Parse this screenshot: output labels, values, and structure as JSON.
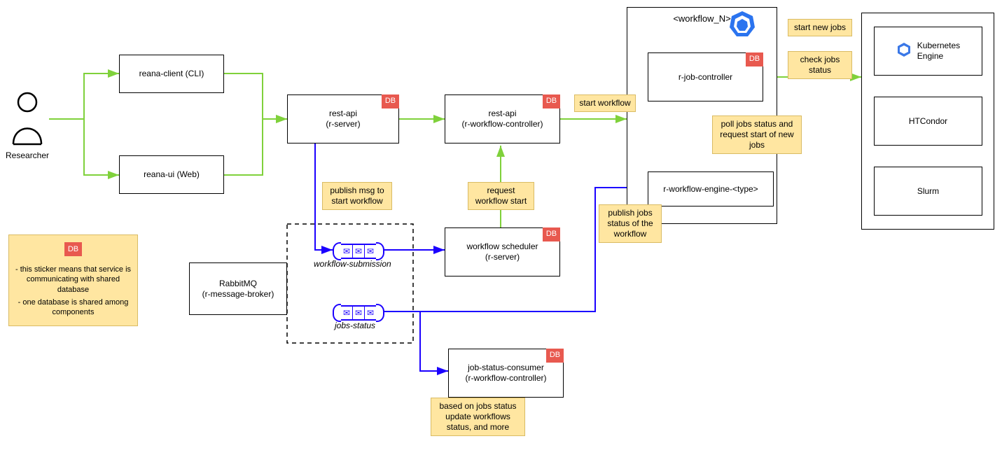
{
  "actor": {
    "label": "Researcher"
  },
  "boxes": {
    "reana_client": "reana-client (CLI)",
    "reana_ui": "reana-ui (Web)",
    "rest_api_server_l1": "rest-api",
    "rest_api_server_l2": "(r-server)",
    "rest_api_wc_l1": "rest-api",
    "rest_api_wc_l2": "(r-workflow-controller)",
    "rabbit_l1": "RabbitMQ",
    "rabbit_l2": "(r-message-broker)",
    "wf_sched_l1": "workflow scheduler",
    "wf_sched_l2": "(r-server)",
    "job_status_l1": "job-status-consumer",
    "job_status_l2": "(r-workflow-controller)",
    "workflow_n_title": "<workflow_N>",
    "r_job_controller": "r-job-controller",
    "r_wf_engine": "r-workflow-engine-<type>",
    "k8s_engine_l1": "Kubernetes",
    "k8s_engine_l2": "Engine",
    "htcondor": "HTCondor",
    "slurm": "Slurm"
  },
  "badges": {
    "db": "DB"
  },
  "queues": {
    "workflow_submission": "workflow-submission",
    "jobs_status": "jobs-status"
  },
  "notes": {
    "publish_start": "publish msg to start workflow",
    "request_start": "request workflow start",
    "start_workflow": "start workflow",
    "publish_jobs": "publish jobs status of the workflow",
    "based_on": "based on jobs status update workflows status, and more",
    "poll_jobs": "poll jobs status and request start of new jobs",
    "start_new": "start new jobs",
    "check_jobs": "check jobs status"
  },
  "legend": {
    "line1": "- this sticker means that service is communicating with shared database",
    "line2": "- one database is shared among components"
  }
}
